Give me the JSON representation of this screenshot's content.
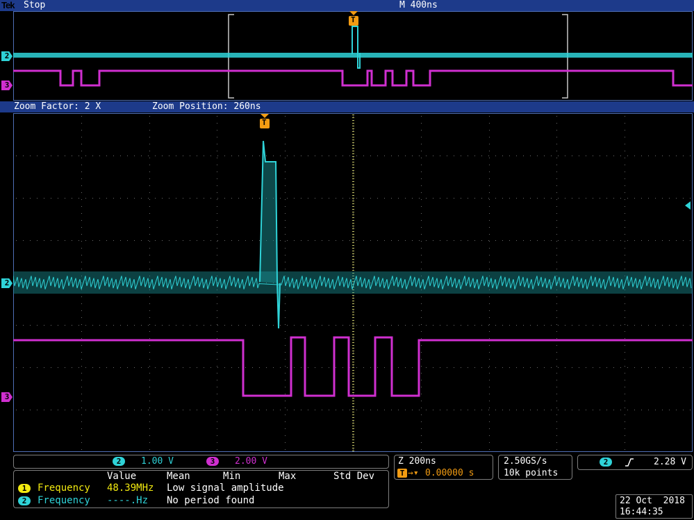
{
  "header": {
    "brand": "Tek",
    "run_state": "Stop",
    "timebase": "M 400ns"
  },
  "zoom": {
    "factor_label": "Zoom Factor: 2 X",
    "position_label": "Zoom Position: 260ns"
  },
  "trigger_marker": "T",
  "channels": [
    {
      "id": "2",
      "color": "#2fd3d8",
      "scale": "1.00 V"
    },
    {
      "id": "3",
      "color": "#d02fd0",
      "scale": "2.00 V"
    }
  ],
  "horizontal": {
    "zoom_scale": "Z 200ns",
    "trigger_delay": "0.00000 s"
  },
  "acquisition": {
    "sample_rate": "2.50GS/s",
    "record_length": "10k points"
  },
  "trigger": {
    "source": "2",
    "slope_icon": "rising-edge",
    "level": "2.28 V"
  },
  "measurements": {
    "headers": [
      "Value",
      "Mean",
      "Min",
      "Max",
      "Std Dev"
    ],
    "rows": [
      {
        "index": "1",
        "name": "Frequency",
        "value": "48.39MHz",
        "note": "Low signal amplitude",
        "color": "#f2ea10",
        "name_color": "#f2ea10"
      },
      {
        "index": "2",
        "name": "Frequency",
        "value": "----.Hz",
        "note": "No period found",
        "color": "#2fd3d8",
        "name_color": "#2fd3d8"
      }
    ]
  },
  "datetime": {
    "date": "22 Oct  2018",
    "time": "16:44:35"
  }
}
